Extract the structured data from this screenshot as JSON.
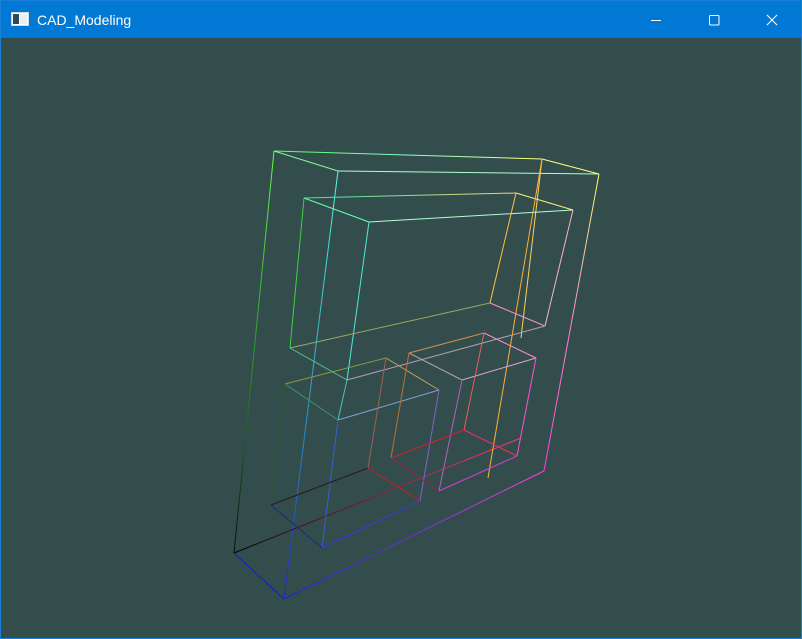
{
  "window": {
    "title": "CAD_Modeling",
    "app_icon": "window-app-icon",
    "controls": {
      "minimize_icon": "minimize-icon",
      "maximize_icon": "maximize-icon",
      "close_icon": "close-icon"
    }
  },
  "colors": {
    "titlebar": "#0078d4",
    "viewport_background": "#334d4d"
  }
}
